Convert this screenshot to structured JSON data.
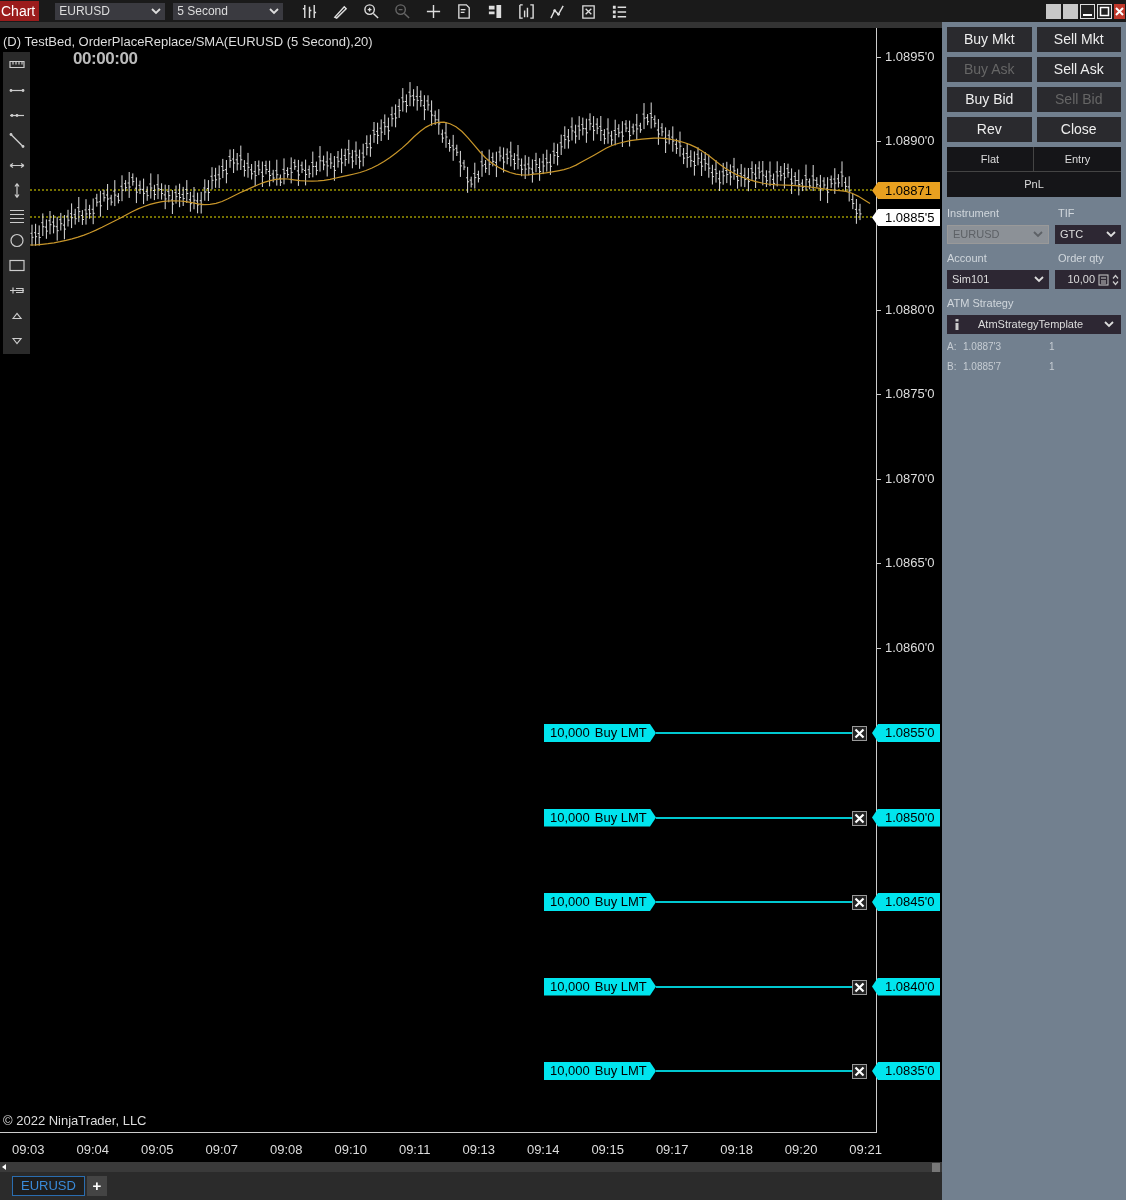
{
  "toolbar": {
    "tab": "Chart",
    "instrument": "EURUSD",
    "interval": "5 Second"
  },
  "chart": {
    "title": "(D) TestBed, OrderPlaceReplace/SMA(EURUSD (5 Second),20)",
    "timer": "00:00:00",
    "price_ticks": [
      "1.0895'0",
      "1.0890'0",
      "1.0880'0",
      "1.0875'0",
      "1.0870'0",
      "1.0865'0",
      "1.0860'0"
    ],
    "last_price": "1.08871",
    "bid_marker": "1.0885'5",
    "orders": [
      {
        "quantity": "10,000",
        "action": "Buy LMT",
        "price": "1.0855'0"
      },
      {
        "quantity": "10,000",
        "action": "Buy LMT",
        "price": "1.0850'0"
      },
      {
        "quantity": "10,000",
        "action": "Buy LMT",
        "price": "1.0845'0"
      },
      {
        "quantity": "10,000",
        "action": "Buy LMT",
        "price": "1.0840'0"
      },
      {
        "quantity": "10,000",
        "action": "Buy LMT",
        "price": "1.0835'0"
      }
    ],
    "copyright": "© 2022 NinjaTrader, LLC",
    "time_ticks": [
      "09:03",
      "09:04",
      "09:05",
      "09:07",
      "09:08",
      "09:10",
      "09:11",
      "09:13",
      "09:14",
      "09:15",
      "09:17",
      "09:18",
      "09:20",
      "09:21"
    ]
  },
  "tabs": [
    {
      "label": "EURUSD",
      "selected": true
    }
  ],
  "add_tab": "+",
  "order_panel": {
    "buttons": [
      {
        "label": "Buy Mkt",
        "disabled": false
      },
      {
        "label": "Sell Mkt",
        "disabled": false
      },
      {
        "label": "Buy Ask",
        "disabled": true
      },
      {
        "label": "Sell Ask",
        "disabled": false
      },
      {
        "label": "Buy Bid",
        "disabled": false
      },
      {
        "label": "Sell Bid",
        "disabled": true
      },
      {
        "label": "Rev",
        "disabled": false
      },
      {
        "label": "Close",
        "disabled": false
      }
    ],
    "position": {
      "flat": "Flat",
      "entry": "Entry",
      "pnl": "PnL"
    },
    "instrument": {
      "label": "Instrument",
      "value": "EURUSD",
      "disabled": true
    },
    "tif": {
      "label": "TIF",
      "value": "GTC"
    },
    "account": {
      "label": "Account",
      "value": "Sim101"
    },
    "order_qty": {
      "label": "Order qty",
      "value": "10,00"
    },
    "atm_strategy": {
      "label": "ATM Strategy",
      "value": "AtmStrategyTemplate"
    },
    "quotes": [
      {
        "side": "A:",
        "price": "1.0887'3",
        "size": "1"
      },
      {
        "side": "B:",
        "price": "1.0885'7",
        "size": "1"
      }
    ]
  }
}
